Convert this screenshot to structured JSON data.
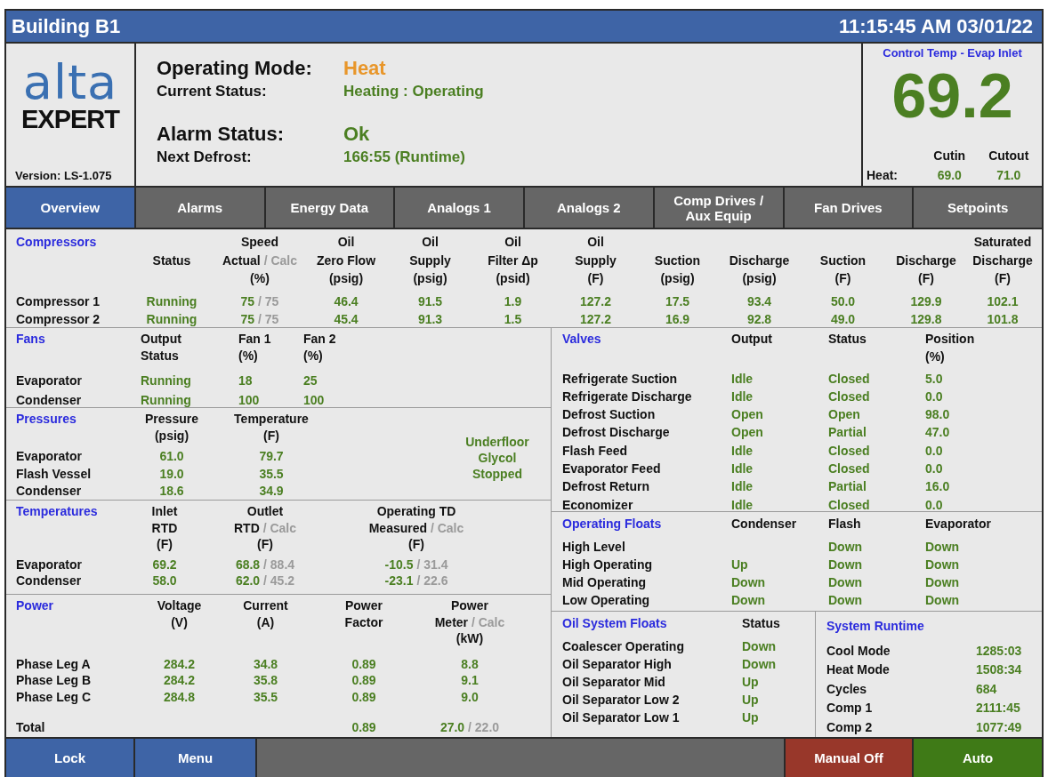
{
  "title_bar": {
    "title": "Building B1",
    "datetime": "11:15:45 AM 03/01/22"
  },
  "logo": {
    "brand": "alta",
    "product": "EXPERT",
    "version": "Version: LS-1.075"
  },
  "status": [
    {
      "label": "Operating Mode:",
      "value": "Heat",
      "kind": "primary",
      "color": "#e8962a"
    },
    {
      "label": "Current Status:",
      "value": "Heating : Operating",
      "kind": "secondary",
      "color": "#4b7f22"
    },
    {
      "label": "Alarm Status:",
      "value": "Ok",
      "kind": "primary",
      "color": "#4b7f22"
    },
    {
      "label": "Next Defrost:",
      "value": "166:55 (Runtime)",
      "kind": "secondary",
      "color": "#4b7f22"
    }
  ],
  "control_temp": {
    "title": "Control Temp - Evap Inlet",
    "value": "69.2",
    "columns": [
      "Cutin",
      "Cutout"
    ],
    "row_label": "Heat:",
    "values": [
      "69.0",
      "71.0"
    ]
  },
  "tabs": [
    {
      "label": "Overview",
      "selected": true
    },
    {
      "label": "Alarms",
      "selected": false
    },
    {
      "label": "Energy Data",
      "selected": false
    },
    {
      "label": "Analogs 1",
      "selected": false
    },
    {
      "label": "Analogs 2",
      "selected": false
    },
    {
      "label": "Comp Drives / Aux Equip",
      "selected": false
    },
    {
      "label": "Fan Drives",
      "selected": false
    },
    {
      "label": "Setpoints",
      "selected": false
    }
  ],
  "compressors": {
    "title": "Compressors",
    "columns": [
      [
        null,
        "Status"
      ],
      [
        "Speed",
        {
          "text": "Actual",
          "alt": "/ Calc"
        },
        "(%)"
      ],
      [
        "Oil",
        "Zero Flow",
        "(psig)"
      ],
      [
        "Oil",
        "Supply",
        "(psig)"
      ],
      [
        "Oil",
        "Filter Δp",
        "(psid)"
      ],
      [
        "Oil",
        "Supply",
        "(F)"
      ],
      [
        null,
        "Suction",
        "(psig)"
      ],
      [
        null,
        "Discharge",
        "(psig)"
      ],
      [
        null,
        "Suction",
        "(F)"
      ],
      [
        null,
        "Discharge",
        "(F)"
      ],
      [
        "Saturated",
        "Discharge",
        "(F)"
      ]
    ],
    "rows": [
      {
        "label": "Compressor 1",
        "values": [
          "Running",
          {
            "text": "75",
            "alt": "/ 75"
          },
          "46.4",
          "91.5",
          "1.9",
          "127.2",
          "17.5",
          "93.4",
          "50.0",
          "129.9",
          "102.1"
        ]
      },
      {
        "label": "Compressor 2",
        "values": [
          "Running",
          {
            "text": "75",
            "alt": "/ 75"
          },
          "45.4",
          "91.3",
          "1.5",
          "127.2",
          "16.9",
          "92.8",
          "49.0",
          "129.8",
          "101.8"
        ]
      }
    ]
  },
  "fans": {
    "title": "Fans",
    "columns": [
      [
        "Output",
        "Status"
      ],
      [
        "Fan 1",
        "(%)"
      ],
      [
        "Fan 2",
        "(%)"
      ]
    ],
    "rows": [
      {
        "label": "Evaporator",
        "values": [
          "Running",
          "18",
          "25"
        ]
      },
      {
        "label": "Condenser",
        "values": [
          "Running",
          "100",
          "100"
        ]
      }
    ]
  },
  "pressures": {
    "title": "Pressures",
    "columns": [
      [
        "Pressure",
        "(psig)"
      ],
      [
        "Temperature",
        "(F)"
      ]
    ],
    "rows": [
      {
        "label": "Evaporator",
        "values": [
          "61.0",
          "79.7"
        ]
      },
      {
        "label": "Flash Vessel",
        "values": [
          "19.0",
          "35.5"
        ]
      },
      {
        "label": "Condenser",
        "values": [
          "18.6",
          "34.9"
        ]
      }
    ],
    "note": "Underfloor Glycol Stopped"
  },
  "temperatures": {
    "title": "Temperatures",
    "columns": [
      [
        "Inlet",
        "RTD",
        "(F)"
      ],
      [
        "Outlet",
        {
          "text": "RTD",
          "alt": "/ Calc"
        },
        "(F)"
      ],
      [
        "Operating TD",
        {
          "text": "Measured",
          "alt": "/ Calc"
        },
        "(F)"
      ]
    ],
    "rows": [
      {
        "label": "Evaporator",
        "values": [
          "69.2",
          {
            "text": "68.8",
            "alt": "/ 88.4"
          },
          {
            "text": "-10.5",
            "alt": "/ 31.4"
          }
        ]
      },
      {
        "label": "Condenser",
        "values": [
          "58.0",
          {
            "text": "62.0",
            "alt": "/ 45.2"
          },
          {
            "text": "-23.1",
            "alt": "/ 22.6"
          }
        ]
      }
    ]
  },
  "power": {
    "title": "Power",
    "columns": [
      [
        "Voltage",
        "(V)"
      ],
      [
        "Current",
        "(A)"
      ],
      [
        "Power",
        "Factor"
      ],
      [
        "Power",
        {
          "text": "Meter",
          "alt": "/ Calc"
        },
        "(kW)"
      ]
    ],
    "rows": [
      {
        "label": "Phase Leg A",
        "values": [
          "284.2",
          "34.8",
          "0.89",
          "8.8"
        ]
      },
      {
        "label": "Phase Leg B",
        "values": [
          "284.2",
          "35.8",
          "0.89",
          "9.1"
        ]
      },
      {
        "label": "Phase Leg C",
        "values": [
          "284.8",
          "35.5",
          "0.89",
          "9.0"
        ]
      }
    ],
    "total": {
      "label": "Total",
      "values": [
        "0.89",
        {
          "text": "27.0",
          "alt": "/ 22.0"
        }
      ]
    }
  },
  "valves": {
    "title": "Valves",
    "columns": [
      [
        "Output"
      ],
      [
        "Status"
      ],
      [
        "Position",
        "(%)"
      ]
    ],
    "rows": [
      {
        "label": "Refrigerate Suction",
        "values": [
          "Idle",
          "Closed",
          "5.0"
        ]
      },
      {
        "label": "Refrigerate Discharge",
        "values": [
          "Idle",
          "Closed",
          "0.0"
        ]
      },
      {
        "label": "Defrost Suction",
        "values": [
          "Open",
          "Open",
          "98.0"
        ]
      },
      {
        "label": "Defrost Discharge",
        "values": [
          "Open",
          "Partial",
          "47.0"
        ]
      },
      {
        "label": "Flash Feed",
        "values": [
          "Idle",
          "Closed",
          "0.0"
        ]
      },
      {
        "label": "Evaporator Feed",
        "values": [
          "Idle",
          "Closed",
          "0.0"
        ]
      },
      {
        "label": "Defrost Return",
        "values": [
          "Idle",
          "Partial",
          "16.0"
        ]
      },
      {
        "label": "Economizer",
        "values": [
          "Idle",
          "Closed",
          "0.0"
        ]
      }
    ]
  },
  "operating_floats": {
    "title": "Operating Floats",
    "columns": [
      [
        "Condenser"
      ],
      [
        "Flash"
      ],
      [
        "Evaporator"
      ]
    ],
    "rows": [
      {
        "label": "High Level",
        "values": [
          "Down",
          "Down"
        ]
      },
      {
        "label": "High Operating",
        "values": [
          "Up",
          "Down",
          "Down"
        ]
      },
      {
        "label": "Mid Operating",
        "values": [
          "Down",
          "Down",
          "Down"
        ]
      },
      {
        "label": "Low Operating",
        "values": [
          "Down",
          "Down",
          "Down"
        ]
      }
    ]
  },
  "oil_system_floats": {
    "title": "Oil System Floats",
    "columns": [
      [
        "Status"
      ]
    ],
    "rows": [
      {
        "label": "Coalescer Operating",
        "values": [
          "Down"
        ]
      },
      {
        "label": "Oil Separator High",
        "values": [
          "Down"
        ]
      },
      {
        "label": "Oil Separator Mid",
        "values": [
          "Up"
        ]
      },
      {
        "label": "Oil Separator Low 2",
        "values": [
          "Up"
        ]
      },
      {
        "label": "Oil Separator Low 1",
        "values": [
          "Up"
        ]
      }
    ]
  },
  "system_runtime": {
    "title": "System Runtime",
    "rows": [
      {
        "label": "Cool Mode",
        "values": [
          "1285:03"
        ]
      },
      {
        "label": "Heat Mode",
        "values": [
          "1508:34"
        ]
      },
      {
        "label": "Cycles",
        "values": [
          "684"
        ]
      },
      {
        "label": "Comp 1",
        "values": [
          "2111:45"
        ]
      },
      {
        "label": "Comp 2",
        "values": [
          "1077:49"
        ]
      }
    ]
  },
  "buttons_left": [
    {
      "label": "Lock",
      "color": "#3e64a6"
    },
    {
      "label": "Menu",
      "color": "#3e64a6"
    }
  ],
  "buttons_right": [
    {
      "label": "Manual Off",
      "color": "#98372a"
    },
    {
      "label": "Auto",
      "color": "#3f7a17"
    }
  ]
}
